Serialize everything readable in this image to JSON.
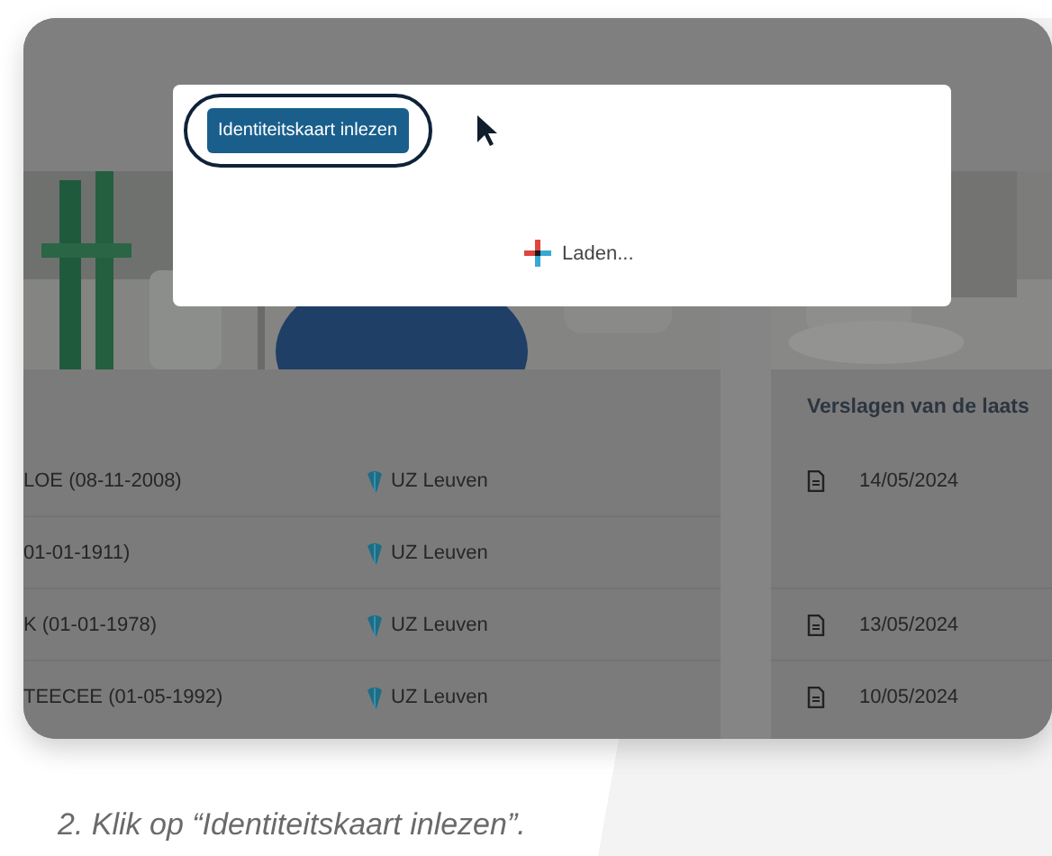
{
  "dialog": {
    "button": "Identiteitskaart inlezen",
    "button_highlighted": true,
    "loading": "Laden..."
  },
  "reports_title": "Verslagen van de laats",
  "rows": [
    {
      "patient": "LOE (08-11-2008)",
      "hospital": "UZ Leuven",
      "report_date": "14/05/2024"
    },
    {
      "patient": "01-01-1911)",
      "hospital": "UZ Leuven"
    },
    {
      "patient": "K (01-01-1978)",
      "hospital": "UZ Leuven",
      "report_date": "13/05/2024"
    },
    {
      "patient": "TEECEE (01-05-1992)",
      "hospital": "UZ Leuven",
      "report_date": "10/05/2024"
    }
  ],
  "caption": "2. Klik op “Identiteitskaart inlezen”."
}
